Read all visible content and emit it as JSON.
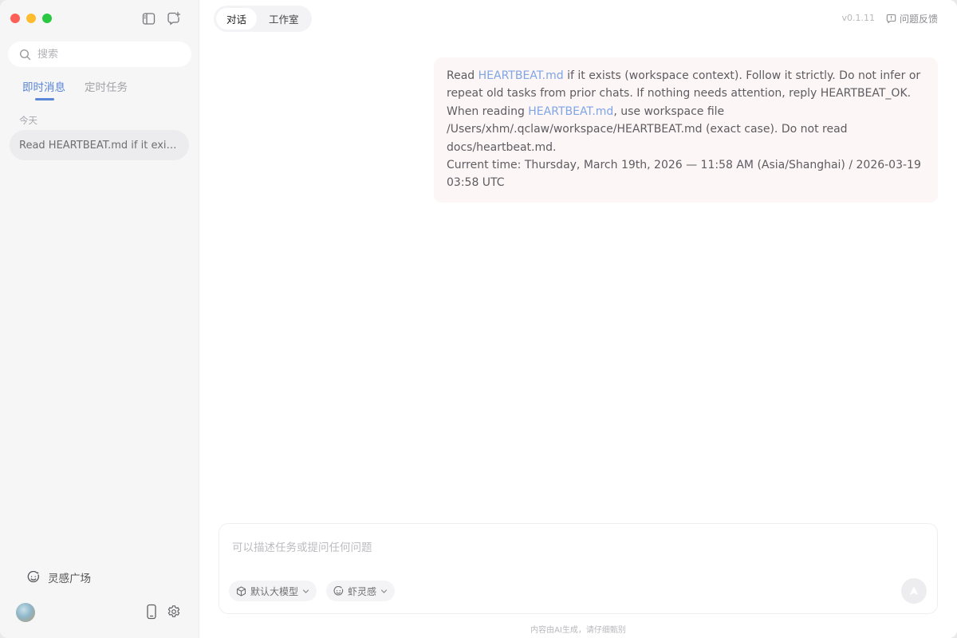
{
  "sidebar": {
    "search_placeholder": "搜索",
    "tabs": [
      {
        "label": "即时消息",
        "active": true
      },
      {
        "label": "定时任务",
        "active": false
      }
    ],
    "date_group": "今天",
    "chats": [
      {
        "title": "Read HEARTBEAT.md if it exists (workspace context)."
      }
    ],
    "inspiration_label": "灵感广场"
  },
  "header": {
    "tabs": [
      {
        "label": "对话",
        "active": true
      },
      {
        "label": "工作室",
        "active": false
      }
    ],
    "version": "v0.1.11",
    "feedback_label": "问题反馈"
  },
  "message": {
    "l1_pre": "Read ",
    "l1_link": "HEARTBEAT.md",
    "l1_post": " if it exists (workspace context). Follow it strictly. Do not infer or repeat old tasks from prior chats. If nothing needs attention, reply HEARTBEAT_OK.",
    "l2_pre": "When reading ",
    "l2_link": "HEARTBEAT.md",
    "l2_post": ", use workspace file /Users/xhm/.qclaw/workspace/HEARTBEAT.md (exact case). Do not read docs/heartbeat.md.",
    "l3": "Current time: Thursday, March 19th, 2026 — 11:58 AM (Asia/Shanghai) / 2026-03-19 03:58 UTC"
  },
  "composer": {
    "placeholder": "可以描述任务或提问任何问题",
    "model_label": "默认大模型",
    "shrimp_label": "虾灵感"
  },
  "footer": {
    "disclaimer": "内容由AI生成，请仔细甄别"
  },
  "colors": {
    "accent": "#5a86d8",
    "bubble_bg": "#fdf6f6",
    "link": "#7ea5e6"
  }
}
